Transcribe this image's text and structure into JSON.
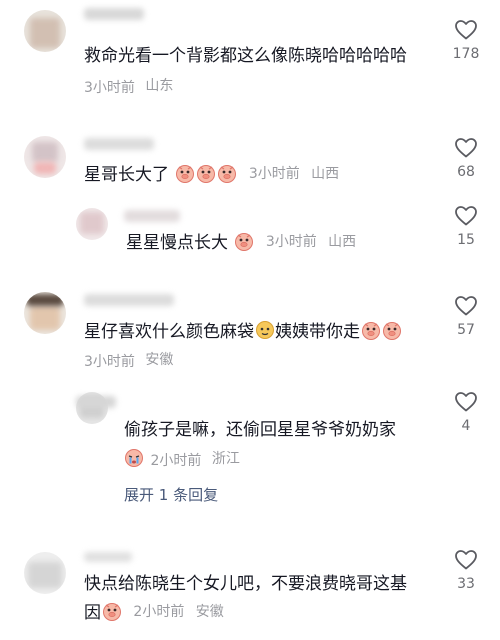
{
  "comments": [
    {
      "text": "救命光看一个背影都这么像陈晓哈哈哈哈哈",
      "time": "3小时前",
      "location": "山东",
      "likes": "178"
    },
    {
      "text": "星哥长大了",
      "time": "3小时前",
      "location": "山西",
      "likes": "68",
      "reply": {
        "text": "星星慢点长大",
        "time": "3小时前",
        "location": "山西",
        "likes": "15"
      }
    },
    {
      "text_a": "星仔喜欢什么颜色麻袋",
      "text_b": "姨姨带你走",
      "time": "3小时前",
      "location": "安徽",
      "likes": "57",
      "reply": {
        "text": "偷孩子是嘛，还偷回星星爷爷奶奶家",
        "time": "2小时前",
        "location": "浙江",
        "likes": "4"
      },
      "expand": "展开 1 条回复"
    },
    {
      "line1": "快点给陈晓生个女儿吧，不要浪费晓哥这基",
      "line2": "因",
      "time": "2小时前",
      "location": "安徽",
      "likes": "33"
    }
  ],
  "colors": {
    "text": "#161823",
    "meta": "#9a9ba0",
    "link": "#4a5a7a"
  },
  "icons": {
    "like": "heart-outline-icon",
    "emoji": "pig-face-emoji-icon",
    "emoji_alt": "crying-face-emoji-icon"
  }
}
